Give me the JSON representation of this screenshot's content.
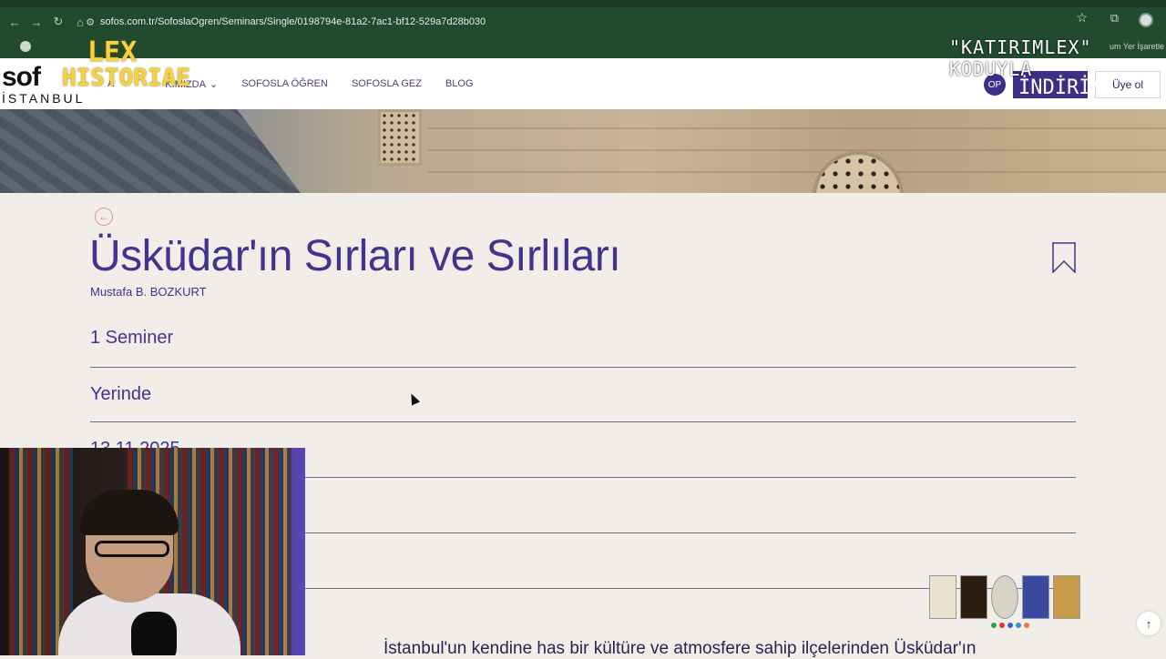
{
  "browser": {
    "url": "sofos.com.tr/SofoslaOgren/Seminars/Single/0198794e-81a2-7ac1-bf12-529a7d28b030",
    "bookmarks_right_text": "um Yer İşaretle"
  },
  "site": {
    "logo_top": "sof",
    "logo_bottom": "İSTANBUL",
    "nav": [
      "A",
      "KIMIZDA",
      "SOFOSLA ÖĞREN",
      "SOFOSLA GEZ",
      "BLOG"
    ],
    "op_badge": "OP",
    "login_label": "",
    "signup_label": "Üye ol"
  },
  "overlay": {
    "brand_line1": "LEX",
    "brand_line2": "HISTORIAE",
    "right_caption": "\"KATIRIMLEX\" KODUYLA",
    "login_overlay": "İNDİRİM"
  },
  "seminar": {
    "title": "Üsküdar'ın Sırları ve Sırlıları",
    "author": "Mustafa B. BOZKURT",
    "rows": [
      "1 Seminer",
      "Yerinde",
      "13.11.2025"
    ],
    "intro": "İstanbul'un kendine has bir kültüre ve atmosfere sahip ilçelerinden Üsküdar'ın"
  },
  "colors": {
    "accent": "#42338c",
    "browser": "#214a2e",
    "back_arrow": "#e27e63"
  },
  "icons": {
    "back": "arrow-left-icon",
    "bookmark": "bookmark-icon",
    "scroll": "arrow-up-icon"
  }
}
